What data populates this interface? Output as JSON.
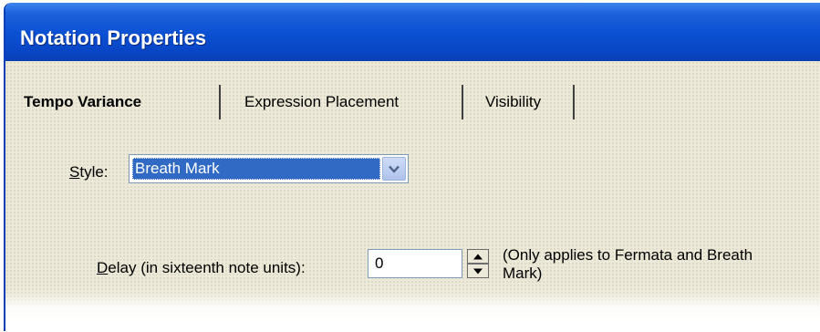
{
  "window": {
    "title": "Notation Properties"
  },
  "tabs": [
    {
      "label": "Tempo Variance",
      "active": true
    },
    {
      "label": "Expression Placement",
      "active": false
    },
    {
      "label": "Visibility",
      "active": false
    }
  ],
  "style": {
    "label_accel": "S",
    "label_rest": "tyle:",
    "selected": "Breath Mark"
  },
  "delay": {
    "label_accel": "D",
    "label_rest": "elay (in sixteenth note units):",
    "value": "0",
    "note_line1": "(Only applies to Fermata and Breath",
    "note_line2": "Mark)"
  },
  "colors": {
    "titlebar": "#0a4fd2",
    "selection": "#316ac5",
    "client_bg": "#ece9d8"
  },
  "icons": {
    "dropdown": "chevron-down-icon",
    "spin_up": "triangle-up-icon",
    "spin_down": "triangle-down-icon"
  }
}
